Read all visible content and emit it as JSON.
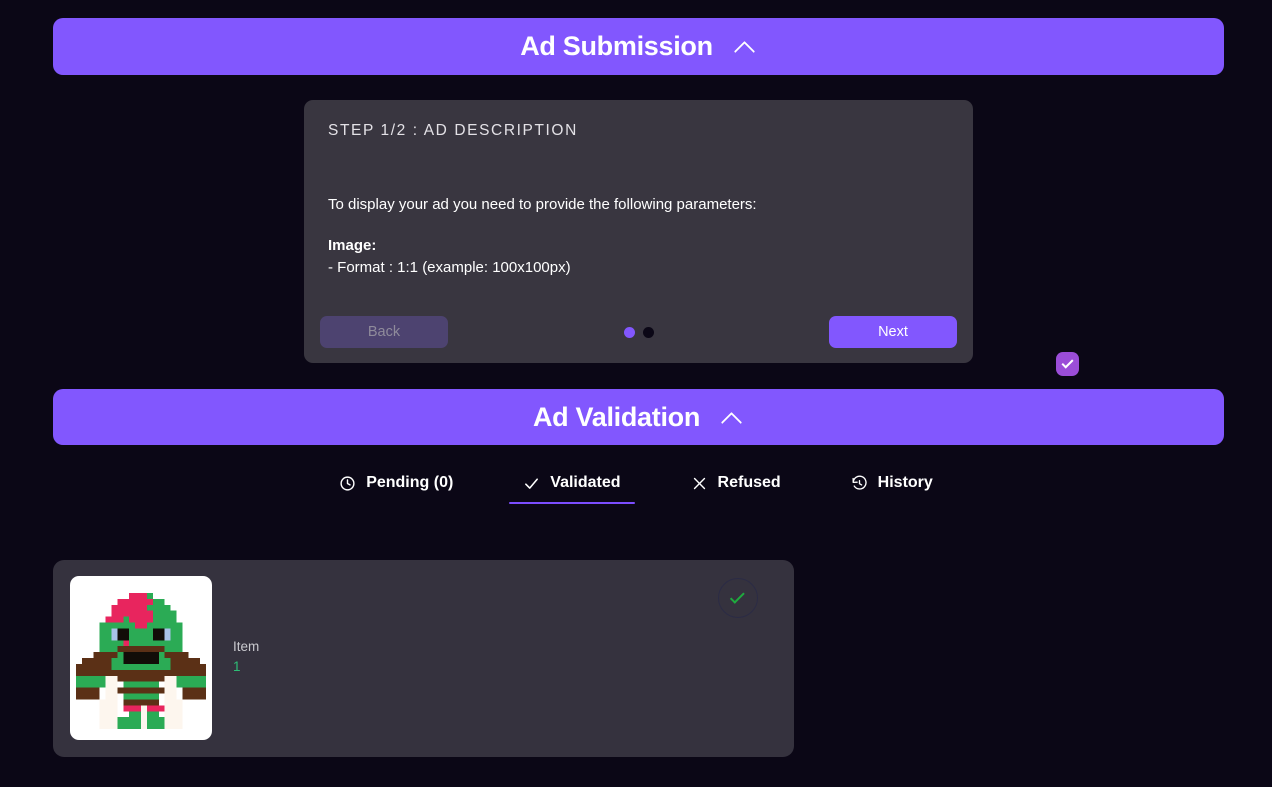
{
  "sections": {
    "submission": {
      "title": "Ad Submission",
      "collapse_icon": "chevron-up-icon"
    },
    "validation": {
      "title": "Ad Validation",
      "collapse_icon": "chevron-up-icon"
    }
  },
  "step_card": {
    "heading": "STEP 1/2 : AD DESCRIPTION",
    "intro": "To display your ad you need to provide the following parameters:",
    "param_title": "Image:",
    "param_line": "- Format : 1:1 (example: 100x100px)",
    "param_checked": true,
    "back_label": "Back",
    "next_label": "Next",
    "dots": [
      {
        "active": true
      },
      {
        "active": false
      }
    ]
  },
  "tabs": [
    {
      "label": "Pending (0)",
      "icon": "clock-icon",
      "active": false
    },
    {
      "label": "Validated",
      "icon": "check-icon",
      "active": true
    },
    {
      "label": "Refused",
      "icon": "close-icon",
      "active": false
    },
    {
      "label": "History",
      "icon": "history-icon",
      "active": false
    }
  ],
  "items": [
    {
      "name": "Item",
      "id": "1",
      "thumbnail": "pixel-avatar-orc",
      "status_icon": "check-circle-icon"
    }
  ],
  "colors": {
    "accent": "#8257fe",
    "background": "#0b0716",
    "card": "#393640",
    "panel": "#35323e",
    "tab_underline": "#7c4dff",
    "item_id": "#2dbe76",
    "status_check": "#1faa3e",
    "checkbox": "#9b4dd8"
  }
}
